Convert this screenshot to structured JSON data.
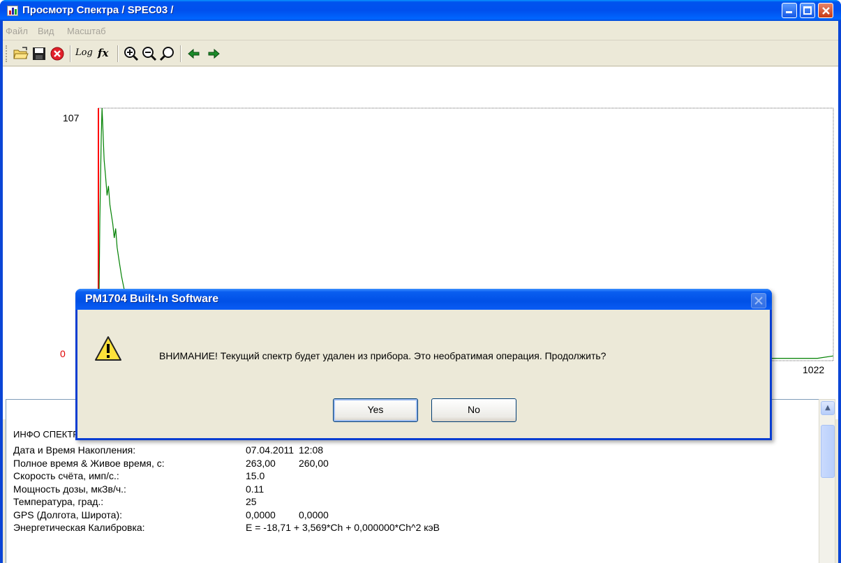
{
  "window": {
    "title": "Просмотр Спектра  / SPEC03 /"
  },
  "menu": {
    "items": [
      "Файл",
      "Вид",
      "Масштаб"
    ]
  },
  "toolbar": {
    "buttons": [
      "open-folder-icon",
      "save-disk-icon",
      "delete-red-icon",
      "Log",
      "fx",
      "zoom-in-icon",
      "zoom-out-icon",
      "zoom-fit-icon",
      "arrow-left-icon",
      "arrow-right-icon"
    ],
    "log_label": "Log",
    "fx_label": "fx"
  },
  "chart_data": {
    "type": "line",
    "title": "",
    "xlabel": "",
    "ylabel": "",
    "ylim": [
      0,
      107
    ],
    "xlim": [
      0,
      1022
    ],
    "y_max_label": "107",
    "y_min_label": "0",
    "x_max_label": "1022",
    "series": [
      {
        "color": "#008000",
        "x": [
          0,
          2,
          4,
          5,
          6,
          8,
          10,
          12,
          14,
          16,
          18,
          20,
          22,
          24,
          26,
          28,
          30,
          32,
          34,
          36,
          38,
          40,
          45,
          50,
          60,
          80,
          120,
          200,
          400,
          700,
          1000,
          1022
        ],
        "values": [
          0,
          60,
          95,
          107,
          100,
          85,
          78,
          70,
          74,
          66,
          62,
          58,
          52,
          56,
          48,
          44,
          40,
          36,
          33,
          30,
          28,
          25,
          20,
          16,
          12,
          8,
          5,
          3,
          2,
          1,
          1,
          2
        ]
      }
    ],
    "marker_line": {
      "color": "#ff0000",
      "x": 0
    }
  },
  "info": {
    "title": "ИНФО СПЕКТРА",
    "rows": [
      {
        "key": "Дата и Время Накопления:",
        "v1": "07.04.2011",
        "v2": "12:08"
      },
      {
        "key": "Полное время & Живое время, с:",
        "v1": "263,00",
        "v2": "260,00"
      },
      {
        "key": "Скорость счёта, имп/с.:",
        "v1": "15.0",
        "v2": ""
      },
      {
        "key": "Мощность дозы, мкЗв/ч.:",
        "v1": "0.11",
        "v2": ""
      },
      {
        "key": "Температура, град.:",
        "v1": "25",
        "v2": ""
      },
      {
        "key": "GPS (Долгота, Широта):",
        "v1": "0,0000",
        "v2": "0,0000"
      },
      {
        "key": "Энергетическая Калибровка:",
        "v1": "E = -18,71 + 3,569*Ch + 0,000000*Ch^2 кэВ",
        "v2": ""
      }
    ]
  },
  "dialog": {
    "title": "PM1704 Built-In Software",
    "message": "ВНИМАНИЕ! Текущий спектр будет удален из прибора. Это необратимая операция. Продолжить?",
    "yes_label": "Yes",
    "no_label": "No",
    "icon": "warning-icon"
  }
}
